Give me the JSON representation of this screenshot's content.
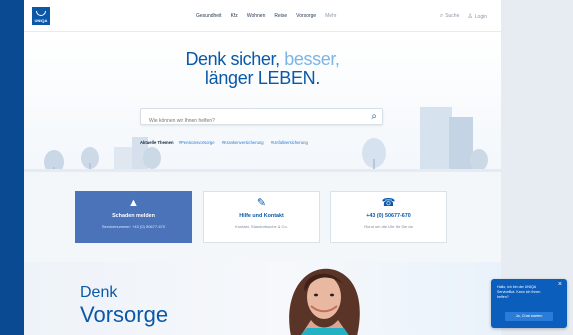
{
  "logo": {
    "brand": "UNIQA",
    "icon": "uniqa-logo-icon"
  },
  "nav": {
    "items": [
      "Gesundheit",
      "Kfz",
      "Wohnen",
      "Reise",
      "Vorsorge",
      "Mehr"
    ],
    "search_label": "Suche",
    "login_label": "Login"
  },
  "hero": {
    "headline_a": "Denk ",
    "headline_b": "sicher,",
    "headline_c": " besser,",
    "headline_line2": "länger LEBEN.",
    "search_placeholder": "Wie können wir Ihnen helfen?",
    "topics_label": "Aktuelle Themen",
    "topics": [
      "#Pensionsvorsorge",
      "#Krankenversicherung",
      "#Unfallversicherung"
    ]
  },
  "services": [
    {
      "icon": "warning-icon",
      "title": "Schaden melden",
      "sub": "Servicenummer: +43 (0) 50677-670"
    },
    {
      "icon": "pen-icon",
      "title": "Hilfe und Kontakt",
      "sub": "Kontakt, Standortsuche & Co."
    },
    {
      "icon": "phone-icon",
      "title": "+43 (0) 50677-670",
      "sub": "Rund um die Uhr für Sie da"
    }
  ],
  "promo": {
    "line1": "Denk",
    "line2": "Vorsorge"
  },
  "chat": {
    "message": "Hallo, ich bin der UNIQA ServiceBot. Kann ich Ihnen helfen?",
    "cta": "Ja, Chat starten",
    "close": "×"
  },
  "colors": {
    "brand": "#0a58a8",
    "primary_tile": "#4a73ba",
    "frame": "#0a4a93"
  }
}
